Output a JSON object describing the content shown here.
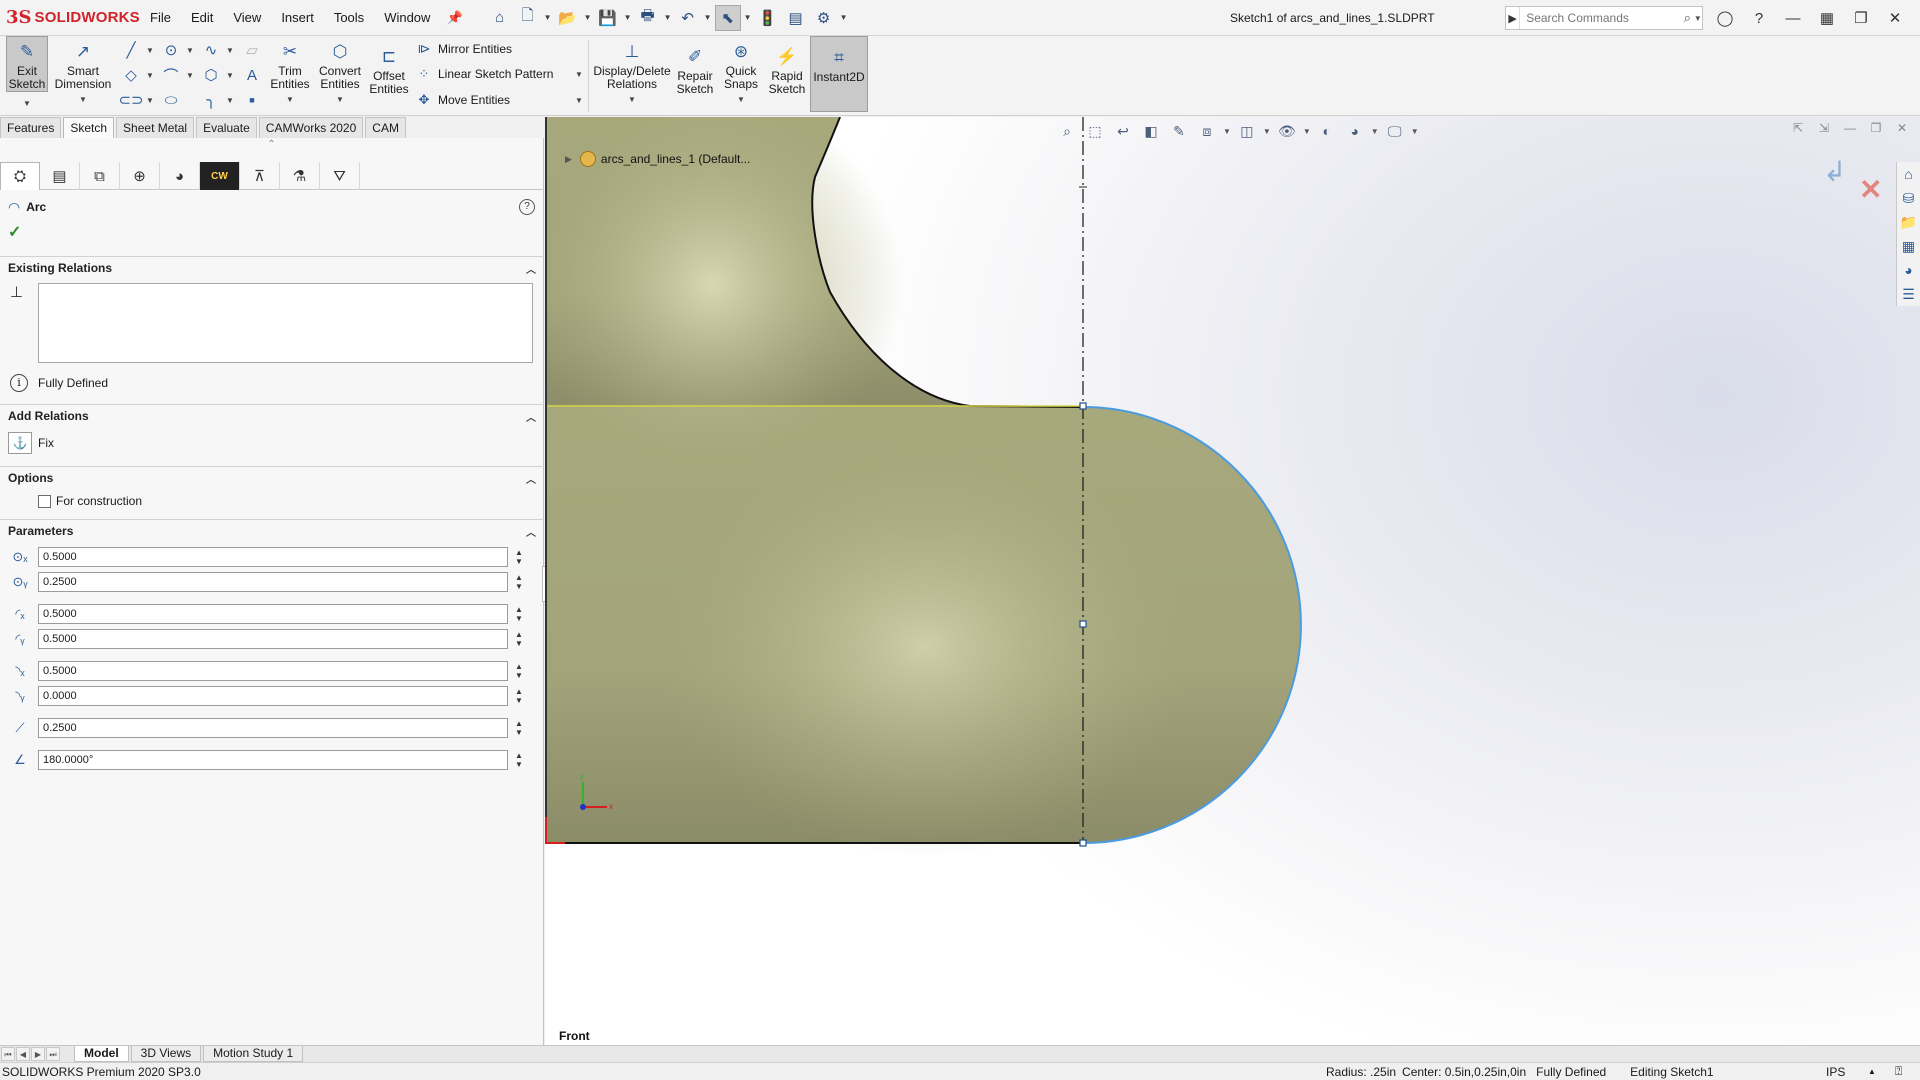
{
  "app": {
    "logo_mark": "3S",
    "brand": "SOLIDWORKS",
    "document_title": "Sketch1 of arcs_and_lines_1.SLDPRT"
  },
  "menu": [
    "File",
    "Edit",
    "View",
    "Insert",
    "Tools",
    "Window"
  ],
  "search": {
    "placeholder": "Search Commands"
  },
  "ribbon": {
    "exit_sketch": "Exit\nSketch",
    "smart_dimension": "Smart\nDimension",
    "trim_entities": "Trim\nEntities",
    "convert_entities": "Convert\nEntities",
    "offset_entities": "Offset\nEntities",
    "mirror_entities": "Mirror Entities",
    "linear_sketch_pattern": "Linear Sketch Pattern",
    "move_entities": "Move Entities",
    "display_delete_relations": "Display/Delete\nRelations",
    "repair_sketch": "Repair\nSketch",
    "quick_snaps": "Quick\nSnaps",
    "rapid_sketch": "Rapid\nSketch",
    "instant2d": "Instant2D"
  },
  "tabs": [
    "Features",
    "Sketch",
    "Sheet Metal",
    "Evaluate",
    "CAMWorks 2020",
    "CAM"
  ],
  "active_tab": "Sketch",
  "property_manager": {
    "title": "Arc",
    "sections": {
      "existing_relations": "Existing Relations",
      "fully_defined": "Fully Defined",
      "add_relations": "Add Relations",
      "fix": "Fix",
      "options": "Options",
      "for_construction": "For construction",
      "parameters": "Parameters"
    },
    "parameters": [
      {
        "icon": "center-x-icon",
        "value": "0.5000"
      },
      {
        "icon": "center-y-icon",
        "value": "0.2500"
      },
      {
        "icon": "start-x-icon",
        "value": "0.5000"
      },
      {
        "icon": "start-y-icon",
        "value": "0.5000"
      },
      {
        "icon": "end-x-icon",
        "value": "0.5000"
      },
      {
        "icon": "end-y-icon",
        "value": "0.0000"
      },
      {
        "icon": "radius-icon",
        "value": "0.2500"
      },
      {
        "icon": "angle-icon",
        "value": "180.0000°"
      }
    ]
  },
  "graphics": {
    "tree_node": "arcs_and_lines_1  (Default...",
    "view_label": "Front",
    "colors": {
      "sketch_fill": "#a8a97a",
      "arc_highlight": "#4a9be0",
      "construction_line": "#222222",
      "horizontal_line": "#d8d84a"
    }
  },
  "bottom_tabs": [
    "Model",
    "3D Views",
    "Motion Study 1"
  ],
  "active_bottom_tab": "Model",
  "status": {
    "version": "SOLIDWORKS Premium 2020 SP3.0",
    "radius": "Radius: .25in",
    "center": "Center: 0.5in,0.25in,0in",
    "defined": "Fully Defined",
    "editing": "Editing Sketch1",
    "units": "IPS"
  }
}
